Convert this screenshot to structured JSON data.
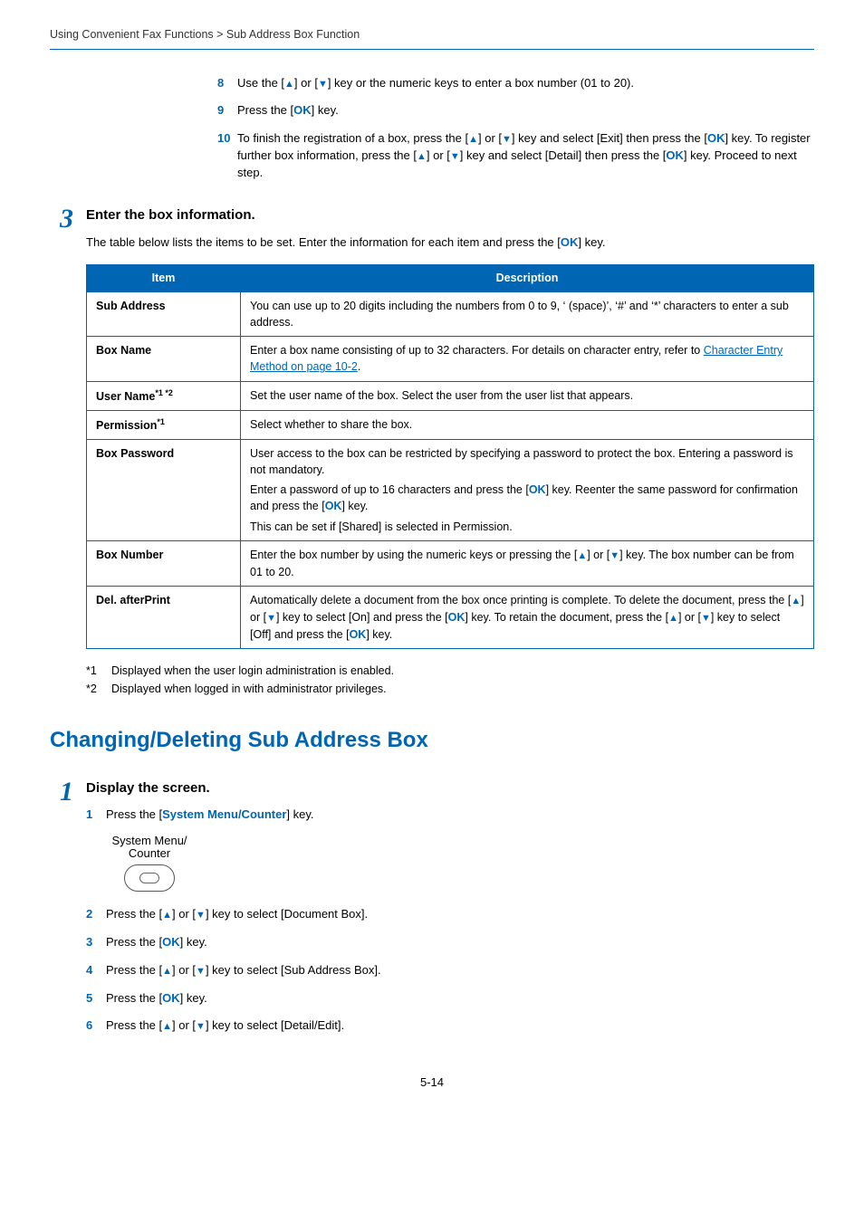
{
  "breadcrumb": "Using Convenient Fax Functions > Sub Address Box Function",
  "steps_top": {
    "s8": "Use the [▲] or [▼] key or the numeric keys to enter a box number (01 to 20).",
    "s9_a": "Press the [",
    "s9_ok": "OK",
    "s9_b": "] key.",
    "s10_a": "To finish the registration of a box, press the [",
    "s10_b": "] or [",
    "s10_c": "] key and select [Exit] then press the [",
    "s10_ok1": "OK",
    "s10_d": "] key. To register further box information, press the [",
    "s10_e": "] or [",
    "s10_f": "] key and select [Detail] then press the [",
    "s10_ok2": "OK",
    "s10_g": "] key. Proceed to next step."
  },
  "section3": {
    "num": "3",
    "title": "Enter the box information.",
    "para_a": "The table below lists the items to be set. Enter the information for each item and press the [",
    "para_ok": "OK",
    "para_b": "] key.",
    "th_item": "Item",
    "th_desc": "Description",
    "rows": {
      "sub_address": {
        "item": "Sub Address",
        "desc": "You can use up to 20 digits including the numbers from 0 to 9, ‘ (space)’, ‘#’ and ‘*’ characters to enter a sub address."
      },
      "box_name": {
        "item": "Box Name",
        "desc_a": "Enter a box name consisting of up to 32 characters. For details on character entry, refer to ",
        "link": "Character Entry Method on page 10-2",
        "desc_b": "."
      },
      "user_name": {
        "item": "User Name",
        "sup": "*1 *2",
        "desc": "Set the user name of the box. Select the user from the user list that appears."
      },
      "permission": {
        "item": "Permission",
        "sup": "*1",
        "desc": "Select whether to share the box."
      },
      "box_password": {
        "item": "Box Password",
        "p1": "User access to the box can be restricted by specifying a password to protect the box. Entering a password is not mandatory.",
        "p2_a": "Enter a password of up to 16 characters and press the [",
        "p2_ok1": "OK",
        "p2_b": "] key. Reenter the same password for confirmation and press the [",
        "p2_ok2": "OK",
        "p2_c": "] key.",
        "p3": "This can be set if [Shared] is selected in Permission."
      },
      "box_number": {
        "item": "Box Number",
        "desc_a": "Enter the box number by using the numeric keys or pressing the [",
        "desc_b": "] or [",
        "desc_c": "] key. The box number can be from 01 to 20."
      },
      "del_after": {
        "item": "Del. afterPrint",
        "desc_a": "Automatically delete a document from the box once printing is complete. To delete the document, press the [",
        "desc_b": "] or [",
        "desc_c": "] key to select [On] and press the [",
        "ok1": "OK",
        "desc_d": "] key. To retain the document, press the [",
        "desc_e": "] or [",
        "desc_f": "] key to select [Off] and press the [",
        "ok2": "OK",
        "desc_g": "] key."
      }
    },
    "fn1": "Displayed when the user login administration is enabled.",
    "fn2": "Displayed when logged in with administrator privileges.",
    "fn1_label": "*1",
    "fn2_label": "*2"
  },
  "h2": "Changing/Deleting Sub Address Box",
  "section1": {
    "num": "1",
    "title": "Display the screen.",
    "s1_a": "Press the [",
    "s1_key": "System Menu/Counter",
    "s1_b": "] key.",
    "key_label_a": "System Menu/",
    "key_label_b": "Counter",
    "s2_a": "Press the [",
    "s2_b": "] or [",
    "s2_c": "] key to select [Document Box].",
    "s3_a": "Press the [",
    "s3_ok": "OK",
    "s3_b": "] key.",
    "s4_a": "Press the [",
    "s4_b": "] or [",
    "s4_c": "] key to select [Sub Address Box].",
    "s5_a": "Press the [",
    "s5_ok": "OK",
    "s5_b": "] key.",
    "s6_a": "Press the [",
    "s6_b": "] or [",
    "s6_c": "] key to select [Detail/Edit]."
  },
  "page_num": "5-14"
}
